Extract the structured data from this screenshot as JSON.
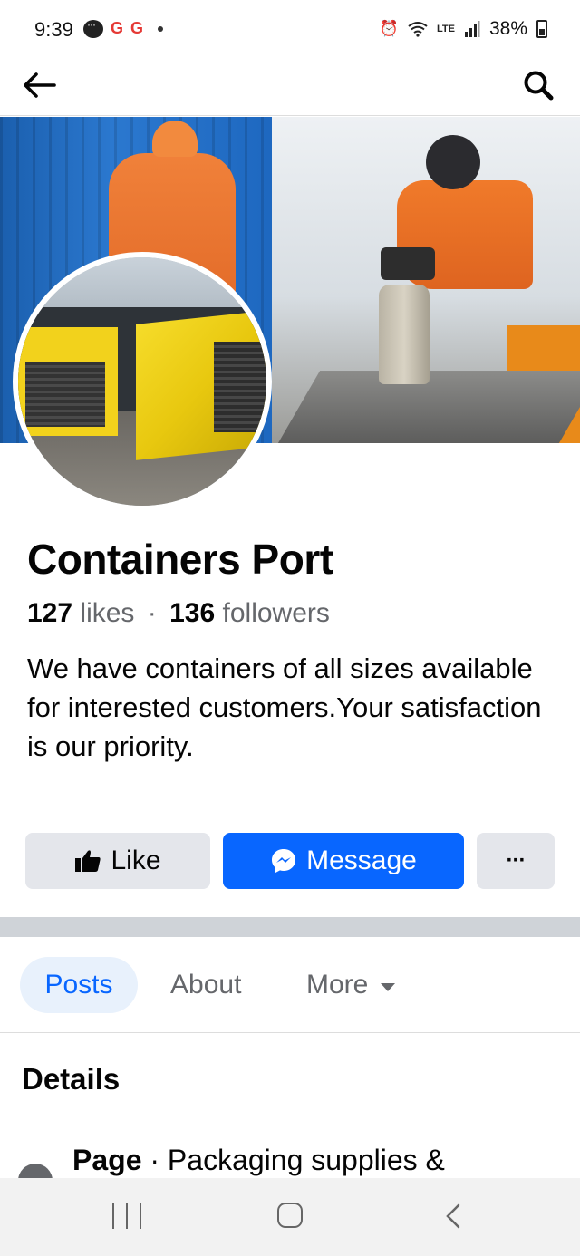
{
  "status_bar": {
    "time": "9:39",
    "battery": "38%",
    "network": "LTE"
  },
  "header": {
    "back_icon": "arrow-left-icon",
    "search_icon": "search-icon"
  },
  "page": {
    "name": "Containers Port",
    "likes_count": "127",
    "likes_label": "likes",
    "separator": "·",
    "followers_count": "136",
    "followers_label": "followers",
    "bio": "We have containers of all sizes available for interested customers.Your satisfaction is our priority."
  },
  "actions": {
    "like_label": "Like",
    "message_label": "Message",
    "more_label": "···"
  },
  "tabs": [
    {
      "label": "Posts",
      "active": true
    },
    {
      "label": "About",
      "active": false
    },
    {
      "label": "More",
      "active": false
    }
  ],
  "details": {
    "title": "Details",
    "row_bold": "Page",
    "row_sep": " · ",
    "row_text": "Packaging supplies &"
  },
  "colors": {
    "accent": "#0866ff",
    "button_gray": "#e4e6eb",
    "secondary_text": "#65676b"
  }
}
